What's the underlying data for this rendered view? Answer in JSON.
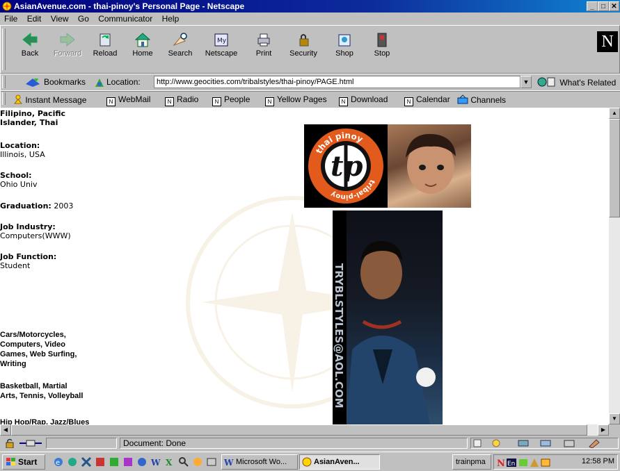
{
  "window": {
    "title": "AsianAvenue.com - thai-pinoy's Personal Page - Netscape",
    "controls": [
      "minimize",
      "maximize",
      "close"
    ]
  },
  "menu": [
    "File",
    "Edit",
    "View",
    "Go",
    "Communicator",
    "Help"
  ],
  "nav": {
    "back": "Back",
    "forward": "Forward",
    "reload": "Reload",
    "home": "Home",
    "search": "Search",
    "netscape": "Netscape",
    "print": "Print",
    "security": "Security",
    "shop": "Shop",
    "stop": "Stop"
  },
  "location": {
    "bookmarks": "Bookmarks",
    "label": "Location:",
    "url": "http://www.geocities.com/tribalstyles/thai-pinoy/PAGE.html",
    "whats_related": "What's Related"
  },
  "personal": [
    "Instant Message",
    "WebMail",
    "Radio",
    "People",
    "Yellow Pages",
    "Download",
    "Calendar",
    "Channels"
  ],
  "profile": {
    "ethnicity_line1": "Filipino, Pacific",
    "ethnicity_line2": "Islander, Thai",
    "location_label": "Location:",
    "location_value": "Illinois, USA",
    "school_label": "School:",
    "school_value": "Ohio Univ",
    "graduation_label": "Graduation:",
    "graduation_value": "2003",
    "job_industry_label": "Job Industry:",
    "job_industry_value": "Computers(WWW)",
    "job_function_label": "Job Function:",
    "job_function_value": "Student"
  },
  "interests": {
    "hobbies": [
      "Cars/Motorcycles,",
      "Computers, Video",
      "Games, Web Surfing,",
      "Writing"
    ],
    "sports": [
      "Basketball, Martial",
      "Arts, Tennis, Volleyball"
    ],
    "music": "Hip Hop/Rap, Jazz/Blues"
  },
  "images": {
    "logo_top": "thai pinoy",
    "logo_bottom": "tribal-pinoy",
    "logo_mark": "tp",
    "photo_side_text": "TRYBLSTYLES@AOL.COM"
  },
  "status": {
    "text": "Document: Done"
  },
  "taskbar": {
    "start": "Start",
    "tasks": [
      "Microsoft Wo...",
      "AsianAven...",
      "trainpma"
    ],
    "clock": "12:58 PM"
  }
}
